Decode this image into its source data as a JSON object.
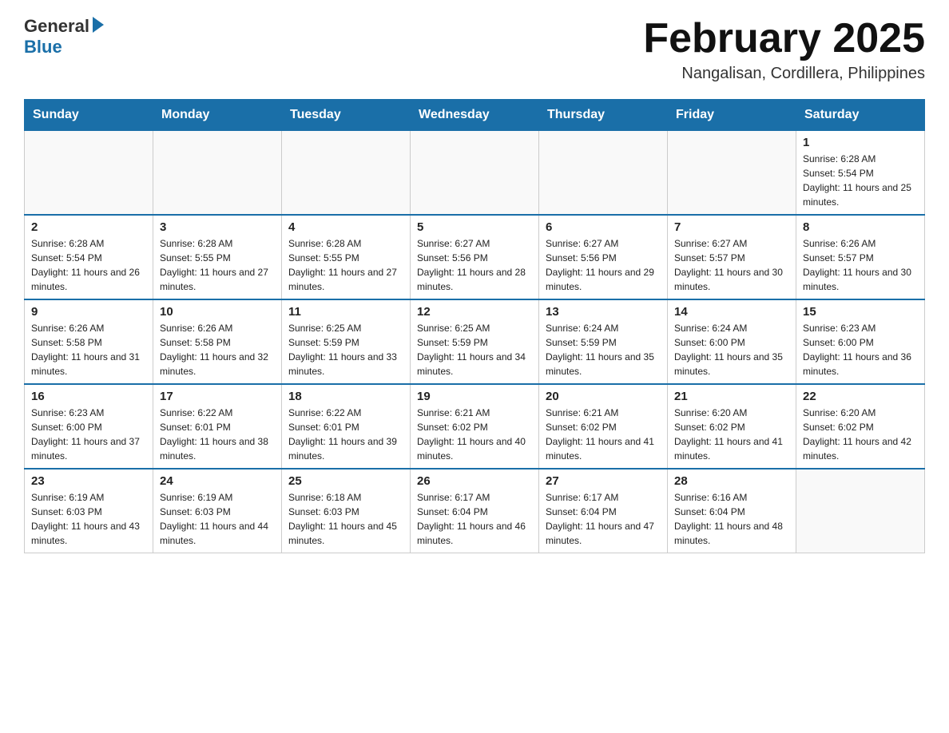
{
  "header": {
    "logo_general": "General",
    "logo_blue": "Blue",
    "month_title": "February 2025",
    "location": "Nangalisan, Cordillera, Philippines"
  },
  "weekdays": [
    "Sunday",
    "Monday",
    "Tuesday",
    "Wednesday",
    "Thursday",
    "Friday",
    "Saturday"
  ],
  "rows": [
    [
      {
        "day": "",
        "info": ""
      },
      {
        "day": "",
        "info": ""
      },
      {
        "day": "",
        "info": ""
      },
      {
        "day": "",
        "info": ""
      },
      {
        "day": "",
        "info": ""
      },
      {
        "day": "",
        "info": ""
      },
      {
        "day": "1",
        "info": "Sunrise: 6:28 AM\nSunset: 5:54 PM\nDaylight: 11 hours and 25 minutes."
      }
    ],
    [
      {
        "day": "2",
        "info": "Sunrise: 6:28 AM\nSunset: 5:54 PM\nDaylight: 11 hours and 26 minutes."
      },
      {
        "day": "3",
        "info": "Sunrise: 6:28 AM\nSunset: 5:55 PM\nDaylight: 11 hours and 27 minutes."
      },
      {
        "day": "4",
        "info": "Sunrise: 6:28 AM\nSunset: 5:55 PM\nDaylight: 11 hours and 27 minutes."
      },
      {
        "day": "5",
        "info": "Sunrise: 6:27 AM\nSunset: 5:56 PM\nDaylight: 11 hours and 28 minutes."
      },
      {
        "day": "6",
        "info": "Sunrise: 6:27 AM\nSunset: 5:56 PM\nDaylight: 11 hours and 29 minutes."
      },
      {
        "day": "7",
        "info": "Sunrise: 6:27 AM\nSunset: 5:57 PM\nDaylight: 11 hours and 30 minutes."
      },
      {
        "day": "8",
        "info": "Sunrise: 6:26 AM\nSunset: 5:57 PM\nDaylight: 11 hours and 30 minutes."
      }
    ],
    [
      {
        "day": "9",
        "info": "Sunrise: 6:26 AM\nSunset: 5:58 PM\nDaylight: 11 hours and 31 minutes."
      },
      {
        "day": "10",
        "info": "Sunrise: 6:26 AM\nSunset: 5:58 PM\nDaylight: 11 hours and 32 minutes."
      },
      {
        "day": "11",
        "info": "Sunrise: 6:25 AM\nSunset: 5:59 PM\nDaylight: 11 hours and 33 minutes."
      },
      {
        "day": "12",
        "info": "Sunrise: 6:25 AM\nSunset: 5:59 PM\nDaylight: 11 hours and 34 minutes."
      },
      {
        "day": "13",
        "info": "Sunrise: 6:24 AM\nSunset: 5:59 PM\nDaylight: 11 hours and 35 minutes."
      },
      {
        "day": "14",
        "info": "Sunrise: 6:24 AM\nSunset: 6:00 PM\nDaylight: 11 hours and 35 minutes."
      },
      {
        "day": "15",
        "info": "Sunrise: 6:23 AM\nSunset: 6:00 PM\nDaylight: 11 hours and 36 minutes."
      }
    ],
    [
      {
        "day": "16",
        "info": "Sunrise: 6:23 AM\nSunset: 6:00 PM\nDaylight: 11 hours and 37 minutes."
      },
      {
        "day": "17",
        "info": "Sunrise: 6:22 AM\nSunset: 6:01 PM\nDaylight: 11 hours and 38 minutes."
      },
      {
        "day": "18",
        "info": "Sunrise: 6:22 AM\nSunset: 6:01 PM\nDaylight: 11 hours and 39 minutes."
      },
      {
        "day": "19",
        "info": "Sunrise: 6:21 AM\nSunset: 6:02 PM\nDaylight: 11 hours and 40 minutes."
      },
      {
        "day": "20",
        "info": "Sunrise: 6:21 AM\nSunset: 6:02 PM\nDaylight: 11 hours and 41 minutes."
      },
      {
        "day": "21",
        "info": "Sunrise: 6:20 AM\nSunset: 6:02 PM\nDaylight: 11 hours and 41 minutes."
      },
      {
        "day": "22",
        "info": "Sunrise: 6:20 AM\nSunset: 6:02 PM\nDaylight: 11 hours and 42 minutes."
      }
    ],
    [
      {
        "day": "23",
        "info": "Sunrise: 6:19 AM\nSunset: 6:03 PM\nDaylight: 11 hours and 43 minutes."
      },
      {
        "day": "24",
        "info": "Sunrise: 6:19 AM\nSunset: 6:03 PM\nDaylight: 11 hours and 44 minutes."
      },
      {
        "day": "25",
        "info": "Sunrise: 6:18 AM\nSunset: 6:03 PM\nDaylight: 11 hours and 45 minutes."
      },
      {
        "day": "26",
        "info": "Sunrise: 6:17 AM\nSunset: 6:04 PM\nDaylight: 11 hours and 46 minutes."
      },
      {
        "day": "27",
        "info": "Sunrise: 6:17 AM\nSunset: 6:04 PM\nDaylight: 11 hours and 47 minutes."
      },
      {
        "day": "28",
        "info": "Sunrise: 6:16 AM\nSunset: 6:04 PM\nDaylight: 11 hours and 48 minutes."
      },
      {
        "day": "",
        "info": ""
      }
    ]
  ]
}
